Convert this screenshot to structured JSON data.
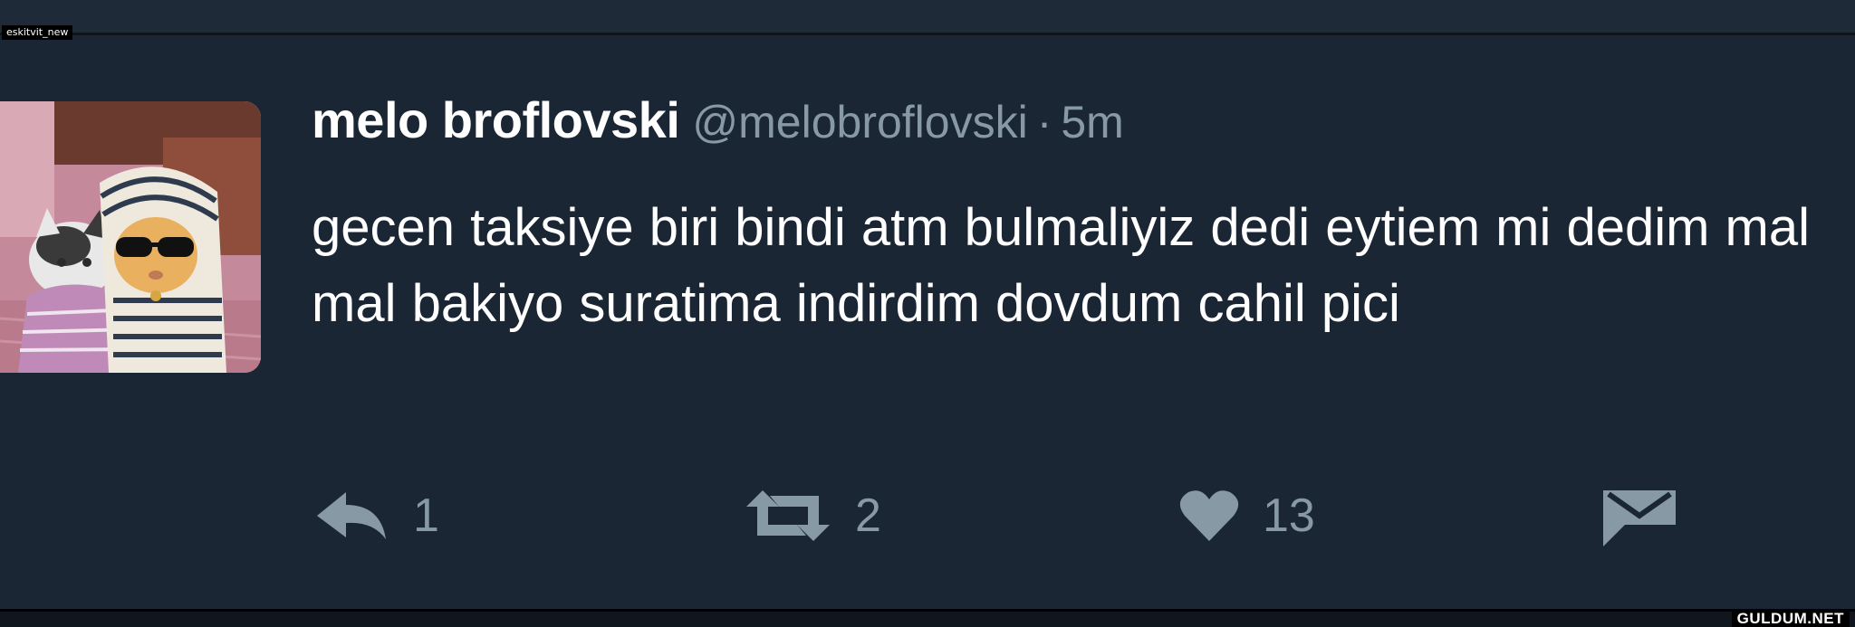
{
  "watermark": {
    "tag": "eskitvit_new",
    "site": "GULDUM.NET"
  },
  "tweet": {
    "display_name": "melo broflovski",
    "handle": "@melobroflovski",
    "separator": "·",
    "time": "5m",
    "text": "gecen taksiye biri bindi atm bulmaliyiz dedi eytiem mi dedim mal mal bakiyo suratima indirdim dovdum cahil pici",
    "avatar_icon": "cats-in-hoodies-photo"
  },
  "actions": {
    "reply": {
      "icon": "reply-icon",
      "count": "1"
    },
    "retweet": {
      "icon": "retweet-icon",
      "count": "2"
    },
    "like": {
      "icon": "heart-icon",
      "count": "13"
    },
    "message": {
      "icon": "envelope-icon"
    }
  },
  "colors": {
    "background": "#1b2634",
    "text": "#ffffff",
    "muted": "#8899a6"
  }
}
